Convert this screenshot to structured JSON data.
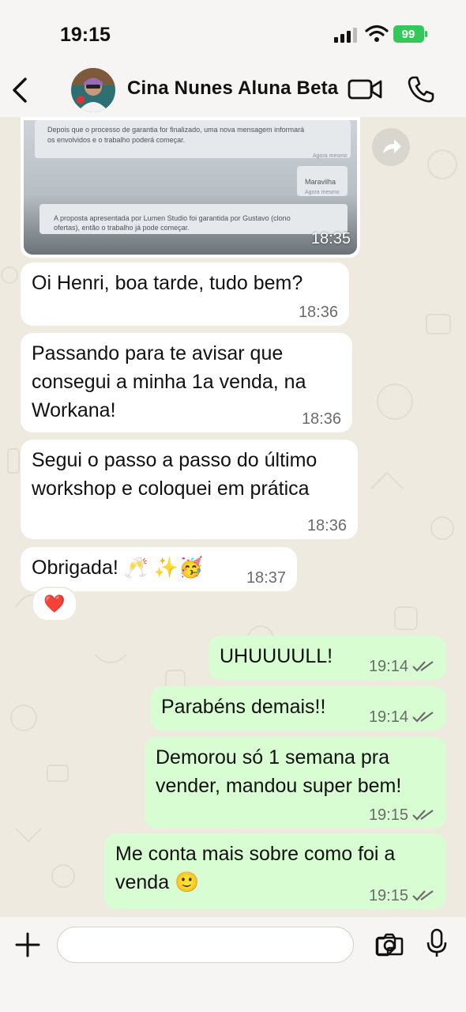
{
  "status_bar": {
    "time": "19:15",
    "battery": "99"
  },
  "header": {
    "contact_name": "Cina Nunes Aluna Beta"
  },
  "image_message": {
    "time": "18:35",
    "screenshot_lines": [
      "Depois que o processo de garantia for finalizado, uma nova mensagem informará",
      "os envolvidos e o trabalho poderá começar.",
      "Agora mesmo",
      "Maravilha",
      "Agora mesmo",
      "A proposta apresentada por Lumen Studio foi garantida por Gustavo (clono",
      "ofertas), então o trabalho já pode começar."
    ]
  },
  "incoming": [
    {
      "text": "Oi Henri, boa tarde, tudo bem?",
      "time": "18:36"
    },
    {
      "text": "Passando para te avisar que consegui a minha 1a venda, na Workana!",
      "time": "18:36"
    },
    {
      "text": "Segui o passo a passo do último workshop e coloquei em prática",
      "time": "18:36"
    },
    {
      "text": "Obrigada! 🥂 ✨🥳",
      "time": "18:37"
    }
  ],
  "reaction": {
    "emoji": "❤️"
  },
  "outgoing": [
    {
      "text": "UHUUUULL!",
      "time": "19:14"
    },
    {
      "text": "Parabéns demais!!",
      "time": "19:14"
    },
    {
      "text": "Demorou só 1 semana pra vender, mandou super bem!",
      "time": "19:15"
    },
    {
      "text": "Me conta mais sobre como foi a venda 🙂",
      "time": "19:15"
    }
  ],
  "composer": {
    "value": "",
    "placeholder": ""
  },
  "colors": {
    "outgoing_bubble": "#d9fdd3",
    "incoming_bubble": "#ffffff",
    "chat_bg": "#efeae0",
    "battery": "#34c759",
    "tick": "#6b6b6b"
  },
  "icons": {
    "back": "chevron-left-icon",
    "video": "video-camera-icon",
    "phone": "phone-icon",
    "forward": "forward-icon",
    "plus": "plus-icon",
    "sticker": "sticker-icon",
    "camera": "camera-icon",
    "mic": "microphone-icon"
  }
}
